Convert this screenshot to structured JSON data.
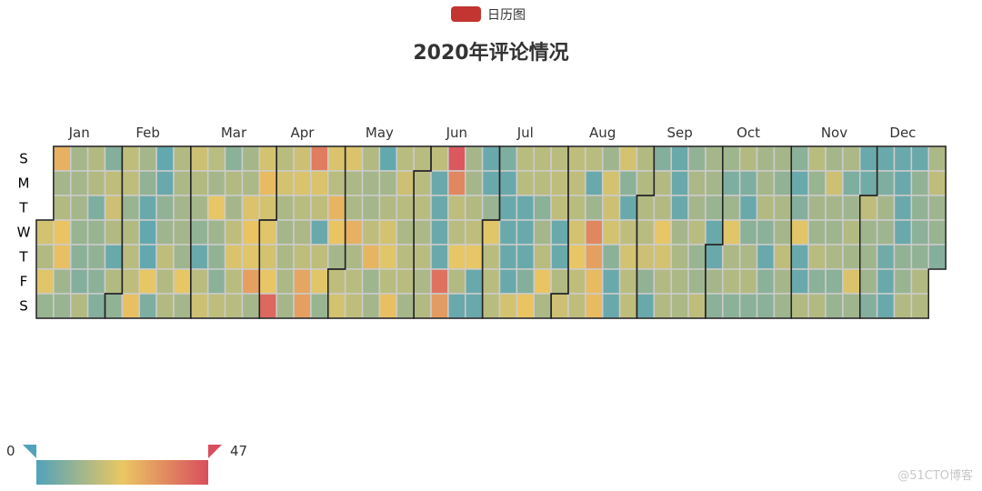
{
  "legend": {
    "label": "日历图",
    "color": "#c23531"
  },
  "watermark": "@51CTO博客",
  "chart_data": {
    "type": "heatmap",
    "subtype": "calendar",
    "title": "2020年评论情况",
    "year": 2020,
    "range": [
      "2020-01-01",
      "2020-12-31"
    ],
    "first_day": "Sunday",
    "day_labels": [
      "S",
      "M",
      "T",
      "W",
      "T",
      "F",
      "S"
    ],
    "month_labels": [
      "Jan",
      "Feb",
      "Mar",
      "Apr",
      "May",
      "Jun",
      "Jul",
      "Aug",
      "Sep",
      "Oct",
      "Nov",
      "Dec"
    ],
    "visual_map": {
      "min": 0,
      "max": 47,
      "min_label": "0",
      "max_label": "47",
      "colors": [
        "#50a3ba",
        "#eac763",
        "#d94e5d"
      ],
      "placement": "bottom-left",
      "orient": "horizontal"
    },
    "weeks": [
      [
        null,
        null,
        null,
        20,
        15,
        22,
        11
      ],
      [
        28,
        13,
        15,
        24,
        25,
        12,
        11
      ],
      [
        13,
        13,
        13,
        11,
        9,
        8,
        15
      ],
      [
        15,
        15,
        7,
        11,
        10,
        9,
        8
      ],
      [
        8,
        17,
        19,
        15,
        4,
        15,
        10
      ],
      [
        17,
        17,
        11,
        15,
        16,
        17,
        25
      ],
      [
        13,
        10,
        4,
        3,
        3,
        23,
        7
      ],
      [
        3,
        4,
        10,
        12,
        17,
        15,
        15
      ],
      [
        15,
        14,
        13,
        13,
        12,
        23,
        13
      ],
      [
        19,
        15,
        13,
        10,
        4,
        16,
        19
      ],
      [
        16,
        13,
        23,
        12,
        10,
        9,
        17
      ],
      [
        9,
        15,
        13,
        17,
        21,
        16,
        16
      ],
      [
        13,
        14,
        21,
        24,
        22,
        31,
        13
      ],
      [
        20,
        26,
        20,
        22,
        20,
        23,
        42
      ],
      [
        16,
        20,
        14,
        13,
        14,
        14,
        13
      ],
      [
        19,
        21,
        16,
        14,
        17,
        30,
        31
      ],
      [
        38,
        21,
        17,
        4,
        17,
        22,
        11
      ],
      [
        21,
        16,
        27,
        24,
        13,
        17,
        20
      ],
      [
        21,
        14,
        14,
        28,
        14,
        16,
        17
      ],
      [
        15,
        13,
        13,
        17,
        27,
        12,
        13
      ],
      [
        3,
        13,
        15,
        20,
        22,
        16,
        25
      ],
      [
        16,
        19,
        16,
        14,
        16,
        16,
        13
      ],
      [
        16,
        16,
        16,
        14,
        16,
        14,
        15
      ],
      [
        17,
        4,
        4,
        4,
        4,
        40,
        32
      ],
      [
        45,
        36,
        17,
        16,
        23,
        15,
        4
      ],
      [
        13,
        13,
        15,
        17,
        23,
        4,
        4
      ],
      [
        4,
        4,
        11,
        22,
        16,
        16,
        16
      ],
      [
        7,
        4,
        4,
        4,
        4,
        4,
        20
      ],
      [
        16,
        16,
        4,
        4,
        4,
        8,
        24
      ],
      [
        16,
        16,
        9,
        13,
        16,
        24,
        14
      ],
      [
        16,
        17,
        17,
        4,
        4,
        15,
        19
      ],
      [
        17,
        17,
        16,
        20,
        23,
        17,
        17
      ],
      [
        16,
        4,
        12,
        36,
        31,
        26,
        26
      ],
      [
        12,
        20,
        19,
        20,
        9,
        4,
        4
      ],
      [
        20,
        9,
        4,
        17,
        20,
        16,
        17
      ],
      [
        15,
        15,
        15,
        16,
        19,
        10,
        4
      ],
      [
        8,
        15,
        15,
        23,
        20,
        15,
        15
      ],
      [
        4,
        4,
        4,
        13,
        14,
        14,
        14
      ],
      [
        10,
        14,
        13,
        16,
        11,
        12,
        17
      ],
      [
        13,
        13,
        11,
        4,
        4,
        13,
        9
      ],
      [
        12,
        7,
        12,
        22,
        14,
        15,
        9
      ],
      [
        15,
        7,
        4,
        9,
        14,
        15,
        9
      ],
      [
        13,
        13,
        15,
        9,
        4,
        9,
        9
      ],
      [
        13,
        10,
        14,
        13,
        17,
        13,
        12
      ],
      [
        9,
        4,
        8,
        22,
        4,
        4,
        15
      ],
      [
        16,
        11,
        13,
        12,
        16,
        9,
        15
      ],
      [
        13,
        19,
        13,
        12,
        14,
        9,
        11
      ],
      [
        14,
        7,
        12,
        15,
        13,
        21,
        12
      ],
      [
        4,
        5,
        17,
        12,
        12,
        12,
        8
      ],
      [
        4,
        7,
        13,
        12,
        5,
        4,
        4
      ],
      [
        4,
        4,
        4,
        4,
        10,
        11,
        15
      ],
      [
        4,
        10,
        10,
        9,
        10,
        15,
        15
      ],
      [
        14,
        17,
        12,
        11,
        8,
        null,
        null
      ]
    ]
  }
}
